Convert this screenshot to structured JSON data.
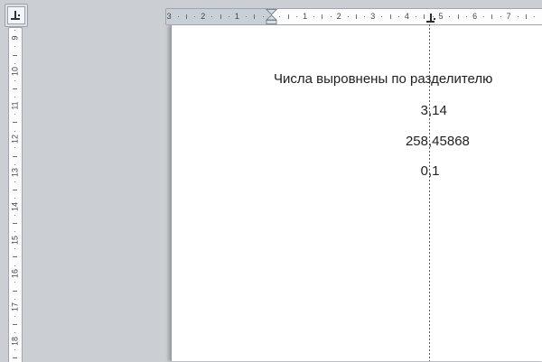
{
  "app": {
    "name": "word-document-editor",
    "colors": {
      "workspace_bg": "#cbced2",
      "ruler_border": "#a0a6ad",
      "ruler_margin_zone": "#c9cfd6",
      "page_bg": "#ffffff",
      "dashed_guide_line": "#5f5f5f",
      "text": "#212121"
    }
  },
  "tab_selector": {
    "icon": "decimal-tab-icon"
  },
  "h_ruler": {
    "numbers_left": [
      "3",
      "2",
      "1"
    ],
    "numbers_right": [
      "1",
      "2",
      "3",
      "4",
      "5",
      "6",
      "7"
    ],
    "tab_stop": {
      "type": "decimal"
    }
  },
  "v_ruler": {
    "numbers": [
      "9",
      "10",
      "11",
      "12",
      "13",
      "14",
      "15",
      "16",
      "17",
      "18"
    ]
  },
  "document": {
    "heading": "Числа выровнены по разделителю",
    "numbers": [
      {
        "value": "3,14",
        "int": "3",
        "frac": ",14"
      },
      {
        "value": "258,45868",
        "int": "258",
        "frac": ",45868"
      },
      {
        "value": "0,1",
        "int": "0",
        "frac": ",1"
      }
    ]
  }
}
